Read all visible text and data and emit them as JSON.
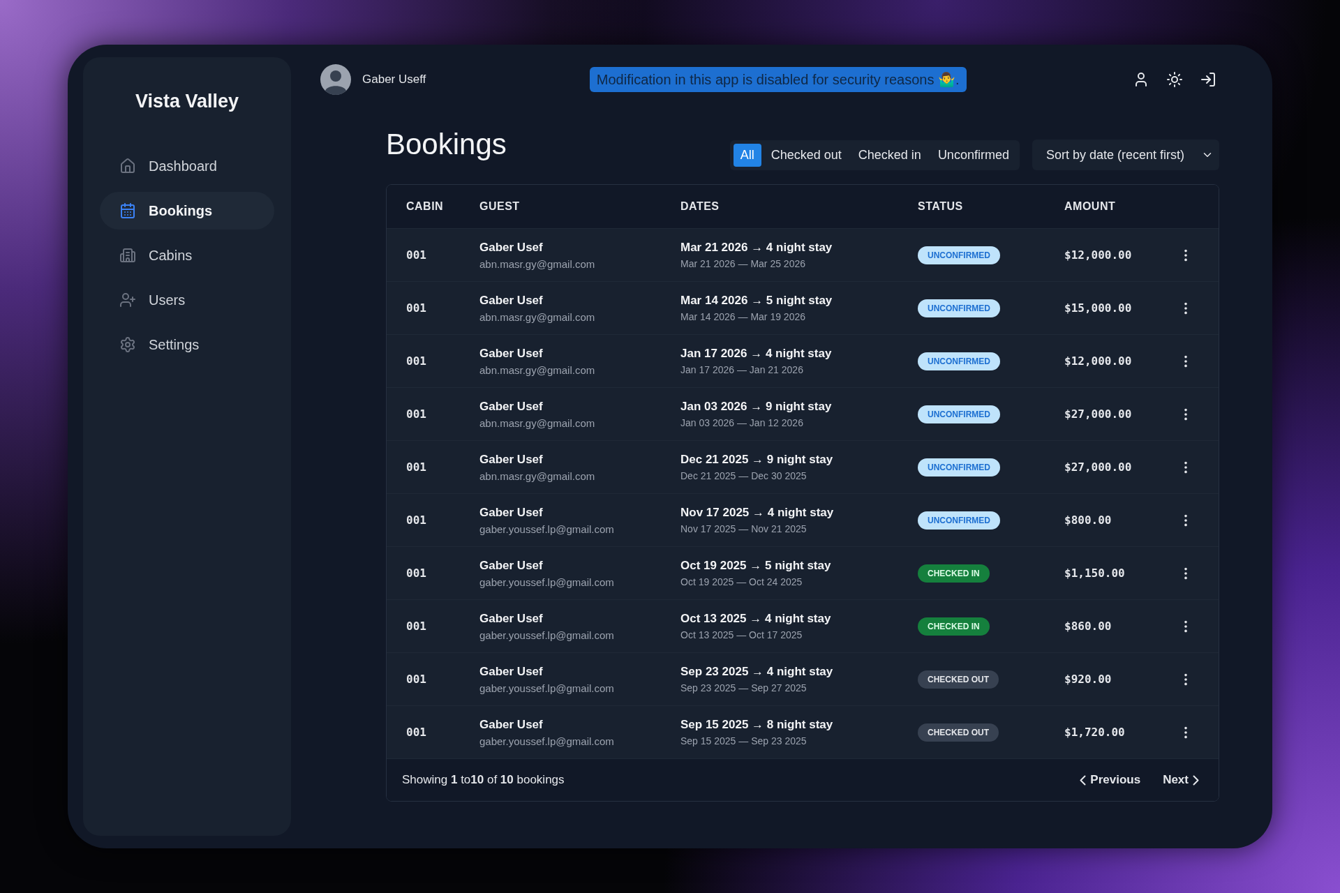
{
  "sidebar": {
    "logo": "Vista Valley",
    "items": [
      {
        "label": "Dashboard",
        "selected": false
      },
      {
        "label": "Bookings",
        "selected": true
      },
      {
        "label": "Cabins",
        "selected": false
      },
      {
        "label": "Users",
        "selected": false
      },
      {
        "label": "Settings",
        "selected": false
      }
    ]
  },
  "header": {
    "user_name": "Gaber Useff",
    "banner": "Modification in this app is disabled for security reasons 🤷‍♂️."
  },
  "page_title": "Bookings",
  "filters": [
    {
      "label": "All",
      "selected": true
    },
    {
      "label": "Checked out",
      "selected": false
    },
    {
      "label": "Checked in",
      "selected": false
    },
    {
      "label": "Unconfirmed",
      "selected": false
    }
  ],
  "sort": {
    "value": "Sort by date (recent first)"
  },
  "table": {
    "columns": [
      "CABIN",
      "GUEST",
      "DATES",
      "STATUS",
      "AMOUNT"
    ],
    "rows": [
      {
        "cabin": "001",
        "guest": "Gaber Usef",
        "email": "abn.masr.gy@gmail.com",
        "stay": "Mar 21 2026 → 4 night stay",
        "range": "Mar 21 2026 — Mar 25 2026",
        "status": "UNCONFIRMED",
        "kind": "unconfirmed",
        "amount": "$12,000.00"
      },
      {
        "cabin": "001",
        "guest": "Gaber Usef",
        "email": "abn.masr.gy@gmail.com",
        "stay": "Mar 14 2026 → 5 night stay",
        "range": "Mar 14 2026 — Mar 19 2026",
        "status": "UNCONFIRMED",
        "kind": "unconfirmed",
        "amount": "$15,000.00"
      },
      {
        "cabin": "001",
        "guest": "Gaber Usef",
        "email": "abn.masr.gy@gmail.com",
        "stay": "Jan 17 2026 → 4 night stay",
        "range": "Jan 17 2026 — Jan 21 2026",
        "status": "UNCONFIRMED",
        "kind": "unconfirmed",
        "amount": "$12,000.00"
      },
      {
        "cabin": "001",
        "guest": "Gaber Usef",
        "email": "abn.masr.gy@gmail.com",
        "stay": "Jan 03 2026 → 9 night stay",
        "range": "Jan 03 2026 — Jan 12 2026",
        "status": "UNCONFIRMED",
        "kind": "unconfirmed",
        "amount": "$27,000.00"
      },
      {
        "cabin": "001",
        "guest": "Gaber Usef",
        "email": "abn.masr.gy@gmail.com",
        "stay": "Dec 21 2025 → 9 night stay",
        "range": "Dec 21 2025 — Dec 30 2025",
        "status": "UNCONFIRMED",
        "kind": "unconfirmed",
        "amount": "$27,000.00"
      },
      {
        "cabin": "001",
        "guest": "Gaber Usef",
        "email": "gaber.youssef.lp@gmail.com",
        "stay": "Nov 17 2025 → 4 night stay",
        "range": "Nov 17 2025 — Nov 21 2025",
        "status": "UNCONFIRMED",
        "kind": "unconfirmed",
        "amount": "$800.00"
      },
      {
        "cabin": "001",
        "guest": "Gaber Usef",
        "email": "gaber.youssef.lp@gmail.com",
        "stay": "Oct 19 2025 → 5 night stay",
        "range": "Oct 19 2025 — Oct 24 2025",
        "status": "CHECKED IN",
        "kind": "checked-in",
        "amount": "$1,150.00"
      },
      {
        "cabin": "001",
        "guest": "Gaber Usef",
        "email": "gaber.youssef.lp@gmail.com",
        "stay": "Oct 13 2025 → 4 night stay",
        "range": "Oct 13 2025 — Oct 17 2025",
        "status": "CHECKED IN",
        "kind": "checked-in",
        "amount": "$860.00"
      },
      {
        "cabin": "001",
        "guest": "Gaber Usef",
        "email": "gaber.youssef.lp@gmail.com",
        "stay": "Sep 23 2025 → 4 night stay",
        "range": "Sep 23 2025 — Sep 27 2025",
        "status": "CHECKED OUT",
        "kind": "checked-out",
        "amount": "$920.00"
      },
      {
        "cabin": "001",
        "guest": "Gaber Usef",
        "email": "gaber.youssef.lp@gmail.com",
        "stay": "Sep 15 2025 → 8 night stay",
        "range": "Sep 15 2025 — Sep 23 2025",
        "status": "CHECKED OUT",
        "kind": "checked-out",
        "amount": "$1,720.00"
      }
    ]
  },
  "footer": {
    "summary": "Showing **1** to**10** of **10** bookings",
    "previous": "Previous",
    "next": "Next"
  }
}
